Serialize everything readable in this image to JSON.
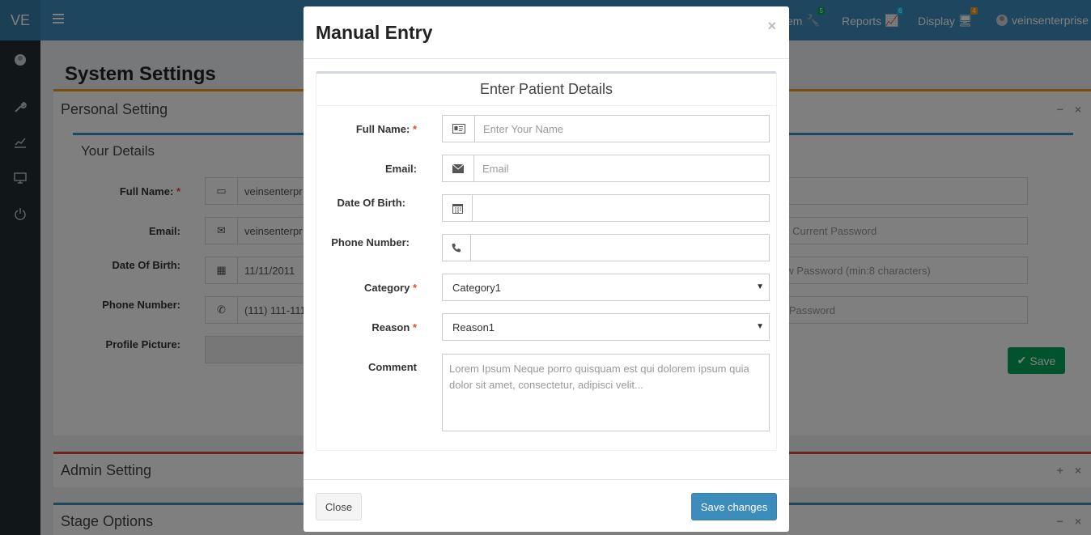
{
  "app": {
    "logo": "VE"
  },
  "sidebar": {
    "icons": [
      "avatar-icon",
      "wrench-icon",
      "chart-icon",
      "monitor-icon",
      "power-icon"
    ]
  },
  "navbar": {
    "items": [
      {
        "label": "em",
        "badge": "5",
        "badge_color": "#00a65a",
        "icon": "wrench-icon"
      },
      {
        "label": "Reports",
        "badge": "6",
        "badge_color": "#00c0ef",
        "icon": "chart-icon"
      },
      {
        "label": "Display",
        "badge": "4",
        "badge_color": "#f39c12",
        "icon": "monitor-icon"
      }
    ],
    "user": "veinsenterprise"
  },
  "page": {
    "title": "System Settings",
    "personal_setting": {
      "title": "Personal Setting",
      "your_details": {
        "title": "Your Details",
        "full_name_label": "Full Name:",
        "full_name_value": "veinsenterpr",
        "email_label": "Email:",
        "email_value": "veinsenterpr",
        "dob_label": "Date Of Birth:",
        "dob_value": "11/11/2011",
        "phone_label": "Phone Number:",
        "phone_value": "(111) 111-111",
        "picture_label": "Profile Picture:"
      },
      "right_fields": {
        "current_password": "ur Current Password",
        "new_password": "ew Password (min:8 characters)",
        "confirm_password": "n Password"
      },
      "save_label": "Save"
    },
    "admin_setting": {
      "title": "Admin Setting"
    },
    "stage_options": {
      "title": "Stage Options"
    }
  },
  "modal": {
    "title": "Manual Entry",
    "close_symbol": "×",
    "panel_title": "Enter Patient Details",
    "fields": {
      "full_name": {
        "label": "Full Name:",
        "required": "*",
        "placeholder": "Enter Your Name"
      },
      "email": {
        "label": "Email:",
        "placeholder": "Email"
      },
      "dob": {
        "label": "Date Of Birth:",
        "value": ""
      },
      "phone": {
        "label": "Phone Number:",
        "value": ""
      },
      "category": {
        "label": "Category",
        "required": "*",
        "selected": "Category1"
      },
      "reason": {
        "label": "Reason",
        "required": "*",
        "selected": "Reason1"
      },
      "comment": {
        "label": "Comment",
        "placeholder": "Lorem Ipsum Neque porro quisquam est qui dolorem ipsum quia dolor sit amet, consectetur, adipisci velit..."
      }
    },
    "footer": {
      "close_label": "Close",
      "save_label": "Save changes"
    }
  },
  "colors": {
    "primary": "#3c8dbc",
    "success": "#00a65a",
    "warning": "#f39c12",
    "danger": "#dd4b39",
    "sidebar": "#222d32"
  }
}
